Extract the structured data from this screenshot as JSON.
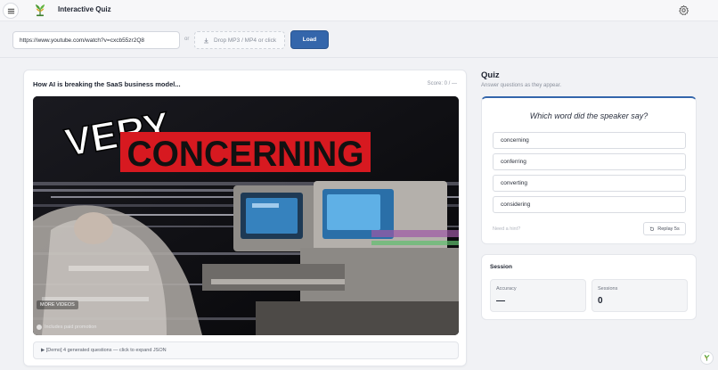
{
  "header": {
    "title": "Interactive Quiz",
    "logo_icon": "plant-logo-icon",
    "menu_icon": "hamburger-menu-icon",
    "settings_icon": "gear-icon"
  },
  "toolbar": {
    "url_value": "https://www.youtube.com/watch?v=cxcb55zr2Q8",
    "or_label": "or",
    "drop_label": "Drop MP3 / MP4 or click",
    "load_label": "Load"
  },
  "video": {
    "title": "How AI is breaking the SaaS business model...",
    "score": "Score: 0 / —",
    "overlay_word1": "VERY",
    "overlay_word2": "CONCERNING",
    "more_videos": "MORE VIDEOS",
    "paid_promo": "Includes paid promotion",
    "demo_summary": "▶ [Demo] 4 generated questions — click to expand JSON"
  },
  "quiz": {
    "heading": "Quiz",
    "subtitle": "Answer questions as they appear.",
    "question": "Which word did the speaker say?",
    "options": [
      "concerning",
      "conferring",
      "converting",
      "considering"
    ],
    "hint": "Need a hint?",
    "replay_label": "Replay 5s"
  },
  "session": {
    "title": "Session",
    "accuracy_label": "Accuracy",
    "accuracy_value": "—",
    "sessions_label": "Sessions",
    "sessions_value": "0"
  },
  "colors": {
    "accent": "#3466ab",
    "overlay_red": "#d71920"
  }
}
